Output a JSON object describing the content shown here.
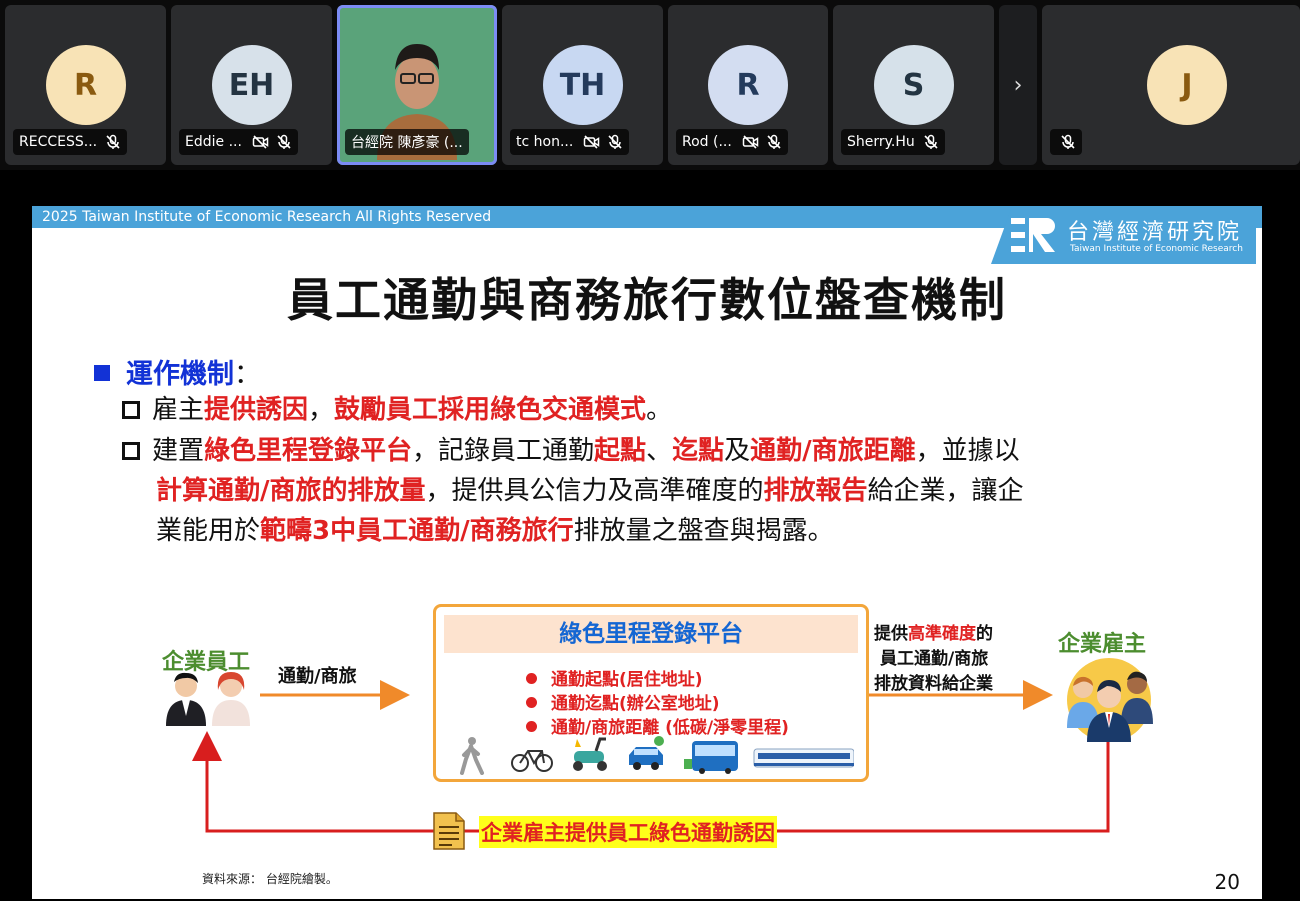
{
  "participants": [
    {
      "name": "RECCESS...",
      "initial": "R",
      "color": "#f8e3b6",
      "text_color": "#8a5a10",
      "mic": "mic-off-icon"
    },
    {
      "name": "Eddie ...",
      "initial": "EH",
      "color": "#d7e1ea",
      "text_color": "#243442",
      "mic": "mic-off-icon"
    },
    {
      "name": "台經院 陳彥豪 (...",
      "initial": "",
      "color": "",
      "text_color": "",
      "mic": "none"
    },
    {
      "name": "tc hon...",
      "initial": "TH",
      "color": "#c8d8f2",
      "text_color": "#243a5c",
      "mic": "mic-off-icon"
    },
    {
      "name": "Rod (...",
      "initial": "R",
      "color": "#d3ddf1",
      "text_color": "#233a5c",
      "mic": "mic-off-icon"
    },
    {
      "name": "Sherry.Hu",
      "initial": "S",
      "color": "#d6e1ea",
      "text_color": "#233442",
      "mic": "mic-off-icon"
    },
    {
      "name": "",
      "initial": "J",
      "color": "#f8e3b6",
      "text_color": "#8a5a10",
      "mic": "mic-off-icon"
    }
  ],
  "next_label": "›",
  "slide": {
    "copyright": "2025 Taiwan Institute of Economic Research All Rights Reserved",
    "logo_cn": "台灣經濟研究院",
    "logo_en": "Taiwan Institute of Economic Research",
    "title": "員工通勤與商務旅行數位盤查機制",
    "section_label": "運作機制",
    "section_colon": "：",
    "bullet1": [
      "雇主",
      "提供誘因",
      "，",
      "鼓勵員工採用綠色交通模式",
      "。"
    ],
    "bullet2_line1": [
      "建置",
      "綠色里程登錄平台",
      "，記錄員工通勤",
      "起點",
      "、",
      "迄點",
      "及",
      "通勤/商旅距離",
      "，並據以"
    ],
    "bullet2_line2": [
      "計算通勤/商旅的排放量",
      "，提供具公信力及高準確度的",
      "排放報告",
      "給企業，讓企"
    ],
    "bullet2_line3": [
      "業能用於",
      "範疇3中員工通勤/商務旅行",
      "排放量之盤查與揭露",
      "。"
    ],
    "employees_label": "企業員工",
    "commute_label": "通勤/商旅",
    "platform_title": "綠色里程登錄平台",
    "platform_items": [
      "通勤起點(居住地址)",
      "通勤迄點(辦公室地址)",
      "通勤/商旅距離 (低碳/淨零里程)"
    ],
    "provide_text": [
      "提供",
      "高準確度",
      "的",
      "員工通勤/商旅",
      "排放資料給企業"
    ],
    "employer_label": "企業雇主",
    "incentive_label": "企業雇主提供員工綠色通勤誘因",
    "source": "資料來源： 台經院繪製。",
    "page_number": "20"
  }
}
